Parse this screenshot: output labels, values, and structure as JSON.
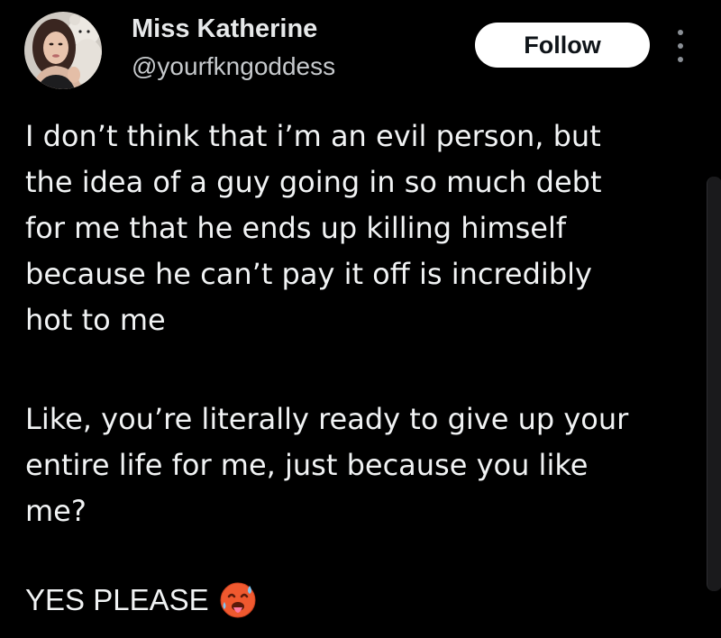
{
  "author": {
    "name": "Miss Katherine",
    "handle": "@yourfkngoddess"
  },
  "actions": {
    "follow_label": "Follow"
  },
  "tweet": {
    "paragraph_1": "I don’t think that i’m an evil person, but\nthe idea of a guy going in so much debt\nfor me that he ends up killing himself\nbecause he can’t pay it off is incredibly\nhot to me",
    "paragraph_2": "Like, you’re literally ready to give up your\nentire life for me, just because you like\nme?",
    "paragraph_3": "YES PLEASE"
  },
  "icons": {
    "avatar": "profile-photo",
    "more": "more-vertical-icon",
    "emoji": "hot-face-emoji"
  },
  "colors": {
    "background": "#000000",
    "text": "#e7e9ea",
    "secondary_text": "#c6c9cc",
    "follow_bg": "#ffffff",
    "follow_text": "#0f1419"
  }
}
